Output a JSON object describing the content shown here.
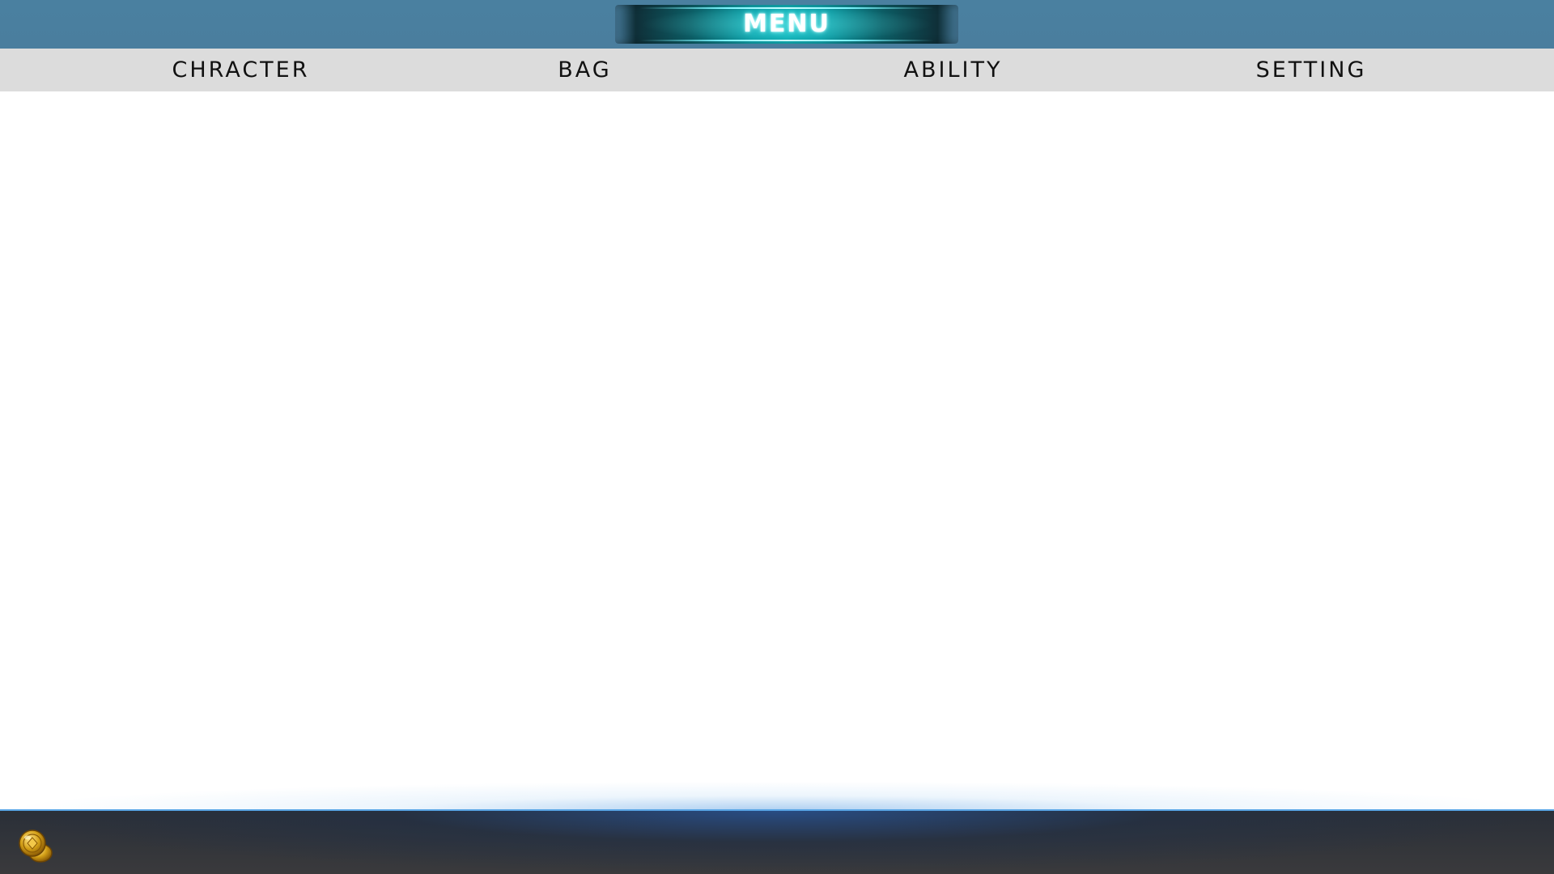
{
  "header": {
    "title": "MENU"
  },
  "tabs": [
    {
      "label": "CHRACTER"
    },
    {
      "label": "BAG"
    },
    {
      "label": "ABILITY"
    },
    {
      "label": "SETTING"
    }
  ],
  "footer": {
    "currency_icon": "gold-coin-stack-icon"
  },
  "colors": {
    "top_bar": "#4a80a0",
    "title_plate_accent": "#12b6bc",
    "tab_bar": "#dcdcdc",
    "content_background": "#ffffff",
    "bottom_bar": "#3a3a3c",
    "bottom_glow": "#5aa6e6",
    "coin": "#d4a017"
  }
}
